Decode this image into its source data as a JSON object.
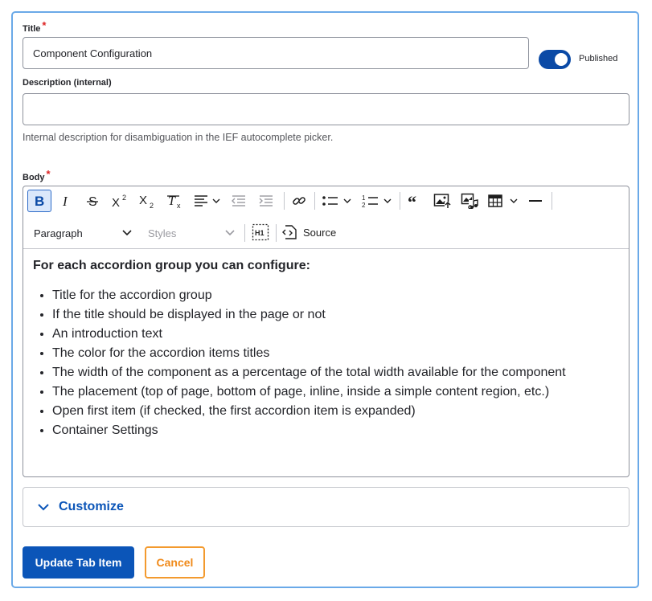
{
  "form": {
    "title_label": "Title",
    "required_mark": "*",
    "title_value": "Component Configuration",
    "published_label": "Published",
    "published_on": true,
    "description_label": "Description (internal)",
    "description_value": "",
    "description_help": "Internal description for disambiguation in the IEF autocomplete picker.",
    "body_label": "Body"
  },
  "toolbar": {
    "buttons": [
      "bold-icon",
      "italic-icon",
      "strikethrough-icon",
      "superscript-icon",
      "subscript-icon",
      "remove-format-icon",
      "align-icon",
      "outdent-icon",
      "indent-icon",
      "link-icon",
      "bulleted-list-icon",
      "numbered-list-icon",
      "blockquote-icon",
      "image-upload-icon",
      "media-icon",
      "table-icon",
      "horizontal-line-icon"
    ],
    "heading_select": "Paragraph",
    "styles_select": "Styles",
    "source_label": "Source"
  },
  "body": {
    "heading": "For each accordion group you can configure:",
    "items": [
      "Title for the accordion group",
      "If the title should be displayed in the page or not",
      "An introduction text",
      "The color for the accordion items titles",
      "The width of the component as a percentage of the total width available for the component",
      "The placement (top of page, bottom of page, inline, inside a simple content region, etc.)",
      "Open first item (if checked, the first accordion item is expanded)",
      "Container Settings"
    ]
  },
  "customize": {
    "label": "Customize"
  },
  "actions": {
    "update_label": "Update Tab Item",
    "cancel_label": "Cancel"
  },
  "colors": {
    "primary": "#0b55b8",
    "cancel": "#f08a1a",
    "frame": "#6aa9e8",
    "required": "#dc2323"
  }
}
